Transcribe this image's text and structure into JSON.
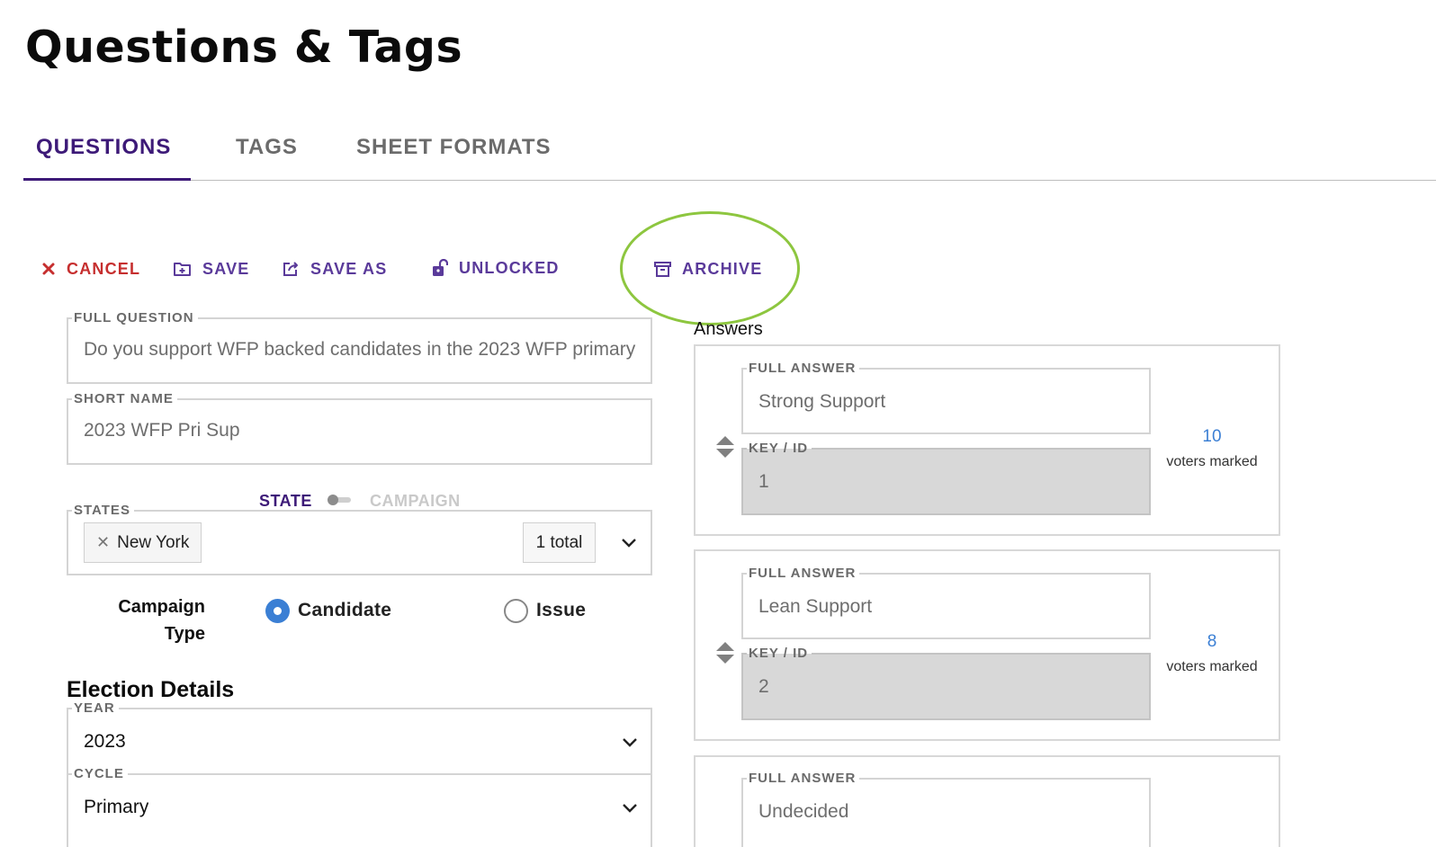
{
  "page": {
    "title": "Questions & Tags"
  },
  "tabs": [
    {
      "label": "QUESTIONS",
      "active": true
    },
    {
      "label": "TAGS",
      "active": false
    },
    {
      "label": "SHEET FORMATS",
      "active": false
    }
  ],
  "toolbar": {
    "cancel": "CANCEL",
    "save": "SAVE",
    "save_as": "SAVE AS",
    "unlocked": "UNLOCKED",
    "archive": "ARCHIVE"
  },
  "colors": {
    "accent": "#3d1a78",
    "danger": "#c62f2f",
    "highlight_ring": "#8dc63f",
    "link": "#3b7fd4"
  },
  "form": {
    "full_question": {
      "label": "FULL QUESTION",
      "value": "Do you support WFP backed candidates in the 2023 WFP primary?"
    },
    "short_name": {
      "label": "SHORT NAME",
      "value": "2023 WFP Pri Sup"
    },
    "scope_toggle": {
      "left": "STATE",
      "right": "CAMPAIGN",
      "selected": "STATE"
    },
    "states": {
      "label": "STATES",
      "chips": [
        "New York"
      ],
      "count": "1 total"
    },
    "campaign_type": {
      "label_line1": "Campaign",
      "label_line2": "Type",
      "options": [
        "Candidate",
        "Issue"
      ],
      "selected": "Candidate"
    }
  },
  "election_details": {
    "heading": "Election Details",
    "year": {
      "label": "YEAR",
      "value": "2023"
    },
    "cycle": {
      "label": "CYCLE",
      "value": "Primary"
    }
  },
  "answers": {
    "title": "Answers",
    "items": [
      {
        "full_answer_label": "FULL ANSWER",
        "full_answer": "Strong Support",
        "key_label": "KEY / ID",
        "key": "1",
        "voters": "10",
        "voters_label": "voters marked"
      },
      {
        "full_answer_label": "FULL ANSWER",
        "full_answer": "Lean Support",
        "key_label": "KEY / ID",
        "key": "2",
        "voters": "8",
        "voters_label": "voters marked"
      },
      {
        "full_answer_label": "FULL ANSWER",
        "full_answer": "Undecided"
      }
    ]
  }
}
